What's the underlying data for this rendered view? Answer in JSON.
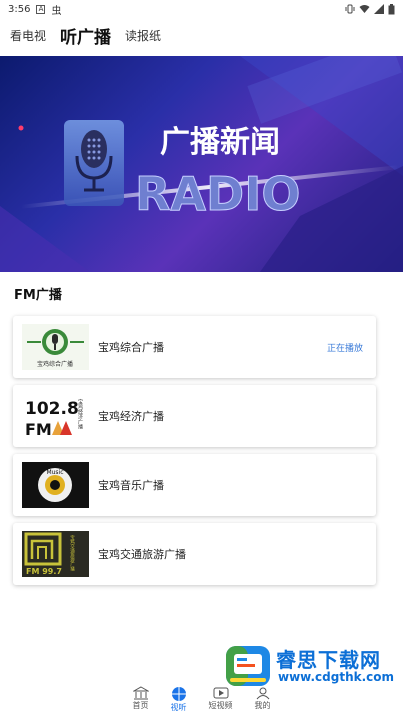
{
  "status_bar": {
    "time": "3:56",
    "notif_a": "A",
    "notif_b": "虫"
  },
  "tabs": [
    {
      "label": "看电视",
      "active": false
    },
    {
      "label": "听广播",
      "active": true
    },
    {
      "label": "读报纸",
      "active": false
    }
  ],
  "banner": {
    "title_cn": "广播新闻",
    "title_en": "RADIO"
  },
  "section": {
    "title": "FM广播"
  },
  "stations": [
    {
      "name": "宝鸡综合广播",
      "status": "正在播放",
      "logo_caption": "宝鸡综合广播"
    },
    {
      "name": "宝鸡经济广播",
      "status": "",
      "logo_text": "102.8",
      "logo_sub": "FM",
      "logo_side": "宝鸡经济广播"
    },
    {
      "name": "宝鸡音乐广播",
      "status": "",
      "logo_text": "Music"
    },
    {
      "name": "宝鸡交通旅游广播",
      "status": "",
      "logo_text": "FM 99.7",
      "logo_side": "宝鸡交通旅游广播"
    }
  ],
  "bottom_nav": [
    {
      "label": "首页",
      "active": false
    },
    {
      "label": "视听",
      "active": true
    },
    {
      "label": "短视频",
      "active": false
    },
    {
      "label": "我的",
      "active": false
    }
  ],
  "watermark": {
    "title": "睿思下载网",
    "url": "www.cdgthk.com"
  }
}
